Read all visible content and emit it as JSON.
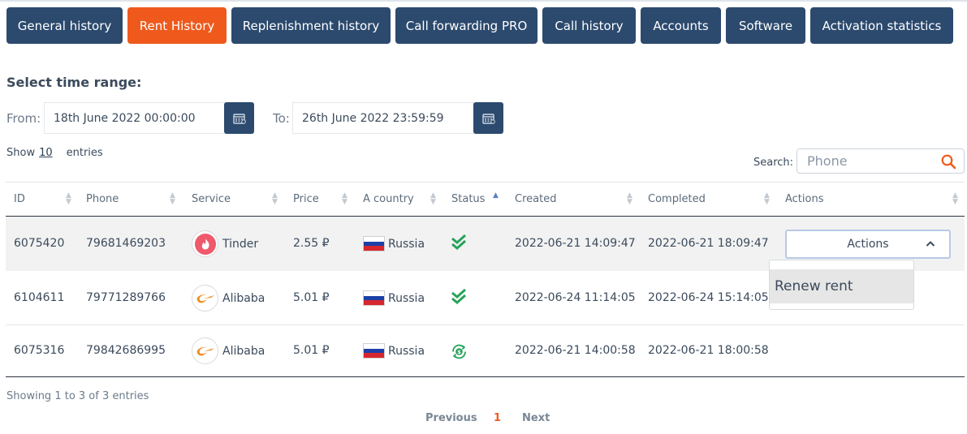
{
  "tabs": [
    {
      "label": "General history",
      "active": false
    },
    {
      "label": "Rent History",
      "active": true
    },
    {
      "label": "Replenishment history",
      "active": false
    },
    {
      "label": "Call forwarding PRO",
      "active": false
    },
    {
      "label": "Call history",
      "active": false
    },
    {
      "label": "Accounts",
      "active": false
    },
    {
      "label": "Software",
      "active": false
    },
    {
      "label": "Activation statistics",
      "active": false
    }
  ],
  "time_range": {
    "title": "Select time range:",
    "from_label": "From:",
    "from_value": "18th June 2022 00:00:00",
    "to_label": "To:",
    "to_value": "26th June 2022 23:59:59",
    "calendar_icon": "calendar-icon"
  },
  "length": {
    "show": "Show",
    "value": "10",
    "entries": "entries"
  },
  "search": {
    "label": "Search:",
    "placeholder": "Phone",
    "icon": "search-icon"
  },
  "table": {
    "columns": [
      "ID",
      "Phone",
      "Service",
      "Price",
      "A country",
      "Status",
      "Created",
      "Completed",
      "Actions"
    ],
    "sorted_column": "Status",
    "rows": [
      {
        "id": "6075420",
        "phone": "79681469203",
        "service": "Tinder",
        "service_icon": "tinder-icon",
        "price": "2.55 ₽",
        "country": "Russia",
        "flag_icon": "russia-flag-icon",
        "status_icon": "double-check-icon",
        "created": "2022-06-21 14:09:47",
        "completed": "2022-06-21 18:09:47"
      },
      {
        "id": "6104611",
        "phone": "79771289766",
        "service": "Alibaba",
        "service_icon": "alibaba-icon",
        "price": "5.01 ₽",
        "country": "Russia",
        "flag_icon": "russia-flag-icon",
        "status_icon": "double-check-icon",
        "created": "2022-06-24 11:14:05",
        "completed": "2022-06-24 15:14:05"
      },
      {
        "id": "6075316",
        "phone": "79842686995",
        "service": "Alibaba",
        "service_icon": "alibaba-icon",
        "price": "5.01 ₽",
        "country": "Russia",
        "flag_icon": "russia-flag-icon",
        "status_icon": "refund-icon",
        "created": "2022-06-21 14:00:58",
        "completed": "2022-06-21 18:00:58"
      }
    ]
  },
  "actions_menu": {
    "button_label": "Actions",
    "items": [
      "Renew rent"
    ]
  },
  "footer": {
    "info": "Showing 1 to 3 of 3 entries",
    "previous": "Previous",
    "page": "1",
    "next": "Next"
  },
  "colors": {
    "primary": "#2c4a6e",
    "accent": "#ef5a1c",
    "status_green": "#27a35a"
  }
}
